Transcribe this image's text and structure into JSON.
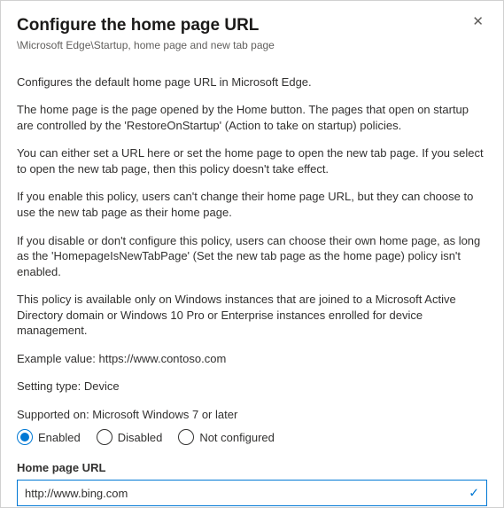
{
  "header": {
    "title": "Configure the home page URL",
    "breadcrumb": "\\Microsoft Edge\\Startup, home page and new tab page"
  },
  "paragraphs": {
    "p1": "Configures the default home page URL in Microsoft Edge.",
    "p2": "The home page is the page opened by the Home button. The pages that open on startup are controlled by the 'RestoreOnStartup' (Action to take on startup) policies.",
    "p3": "You can either set a URL here or set the home page to open the new tab page. If you select to open the new tab page, then this policy doesn't take effect.",
    "p4": "If you enable this policy, users can't change their home page URL, but they can choose to use the new tab page as their home page.",
    "p5": "If you disable or don't configure this policy, users can choose their own home page, as long as the 'HomepageIsNewTabPage' (Set the new tab page as the home page) policy isn't enabled.",
    "p6": "This policy is available only on Windows instances that are joined to a Microsoft Active Directory domain or Windows 10 Pro or Enterprise instances enrolled for device management.",
    "p7": "Example value: https://www.contoso.com",
    "p8": "Setting type: Device",
    "p9": "Supported on: Microsoft Windows 7 or later"
  },
  "radio": {
    "enabled": "Enabled",
    "disabled": "Disabled",
    "not_configured": "Not configured",
    "selected": "enabled"
  },
  "field": {
    "label": "Home page URL",
    "value": "http://www.bing.com"
  },
  "icons": {
    "close": "✕",
    "check": "✓"
  }
}
